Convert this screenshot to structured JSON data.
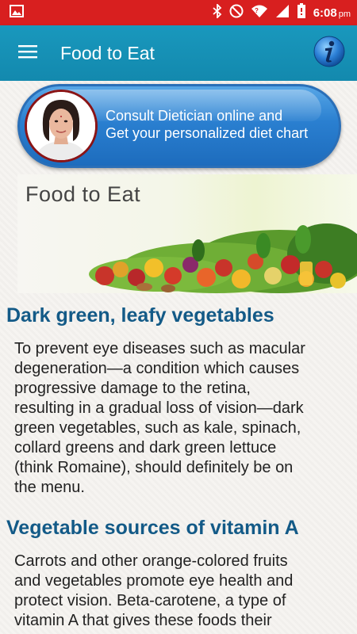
{
  "status_bar": {
    "time": "6:08",
    "ampm": "pm",
    "icons": [
      "image-icon",
      "bluetooth-icon",
      "do-not-disturb-icon",
      "wifi-icon",
      "signal-icon",
      "battery-icon"
    ],
    "color": "#d81f1f"
  },
  "app_bar": {
    "title": "Food to Eat",
    "menu_icon": "hamburger-menu-icon",
    "info_icon": "info-icon",
    "color": "#1690b5"
  },
  "consult_banner": {
    "line1": "Consult Dietician online and",
    "line2": "Get your personalized diet chart"
  },
  "food_banner": {
    "title": "Food to Eat"
  },
  "sections": [
    {
      "heading": "Dark green, leafy vegetables",
      "lines": [
        "To prevent eye diseases such as macular",
        "degeneration—a condition which causes",
        "progressive damage to the retina,",
        "resulting in a gradual loss of vision—dark",
        "green vegetables, such as kale, spinach,",
        "collard greens and dark green lettuce",
        "(think Romaine), should definitely be on",
        "the menu."
      ]
    },
    {
      "heading": "Vegetable sources of vitamin A",
      "lines": [
        "Carrots and other orange-colored fruits",
        "and vegetables promote eye health and",
        "protect vision. Beta-carotene, a type of",
        "vitamin A that gives these foods their"
      ]
    }
  ]
}
